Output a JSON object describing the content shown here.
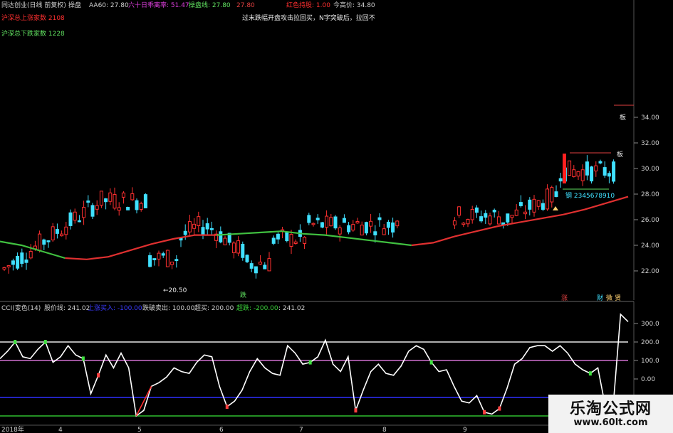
{
  "header": {
    "items": [
      {
        "text": "同达创业(日线 前复权)",
        "color": "#cfcfcf"
      },
      {
        "text": "操盘",
        "color": "#cfcfcf"
      },
      {
        "text": "AA60: 27.80",
        "color": "#cfcfcf"
      },
      {
        "text": "六十日乖离率: 51.47",
        "color": "#e040e0"
      },
      {
        "text": "操盘线: 27.80",
        "color": "#60e060"
      },
      {
        "text": "27.80",
        "color": "#e04040"
      },
      {
        "text": "红色持股: 1.00",
        "color": "#ff3030"
      },
      {
        "text": "今高价: 34.80",
        "color": "#cfcfcf"
      }
    ],
    "line2": "过末跌幅开盘攻击拉回买，N字突破后，拉回不",
    "up_count": "沪深总上涨家数 2108",
    "down_count": "沪深总下跌家数 1228"
  },
  "upper": {
    "price_ticks": [
      "34.00",
      "32.00",
      "30.00",
      "28.00",
      "26.00",
      "24.00",
      "22.00"
    ],
    "annot_low": "←20.50",
    "annot_die": "跌",
    "annot_ban1": "板",
    "annot_ban2": "板",
    "annot_seq": "钢 2345678910",
    "annot_zhang": "涨",
    "annot_cai": "财",
    "annot_wei": "微",
    "annot_zhe": "贤"
  },
  "lower": {
    "header": [
      {
        "text": "CCI(变色(14)",
        "color": "#cfcfcf"
      },
      {
        "text": "股价线: 241.02",
        "color": "#cfcfcf"
      },
      {
        "text": "上涨买入: -100.00",
        "color": "#3a3aff"
      },
      {
        "text": "跌破卖出: 100.00",
        "color": "#cfcfcf"
      },
      {
        "text": "超买: 200.00",
        "color": "#cfcfcf"
      },
      {
        "text": "超跌: -200.00",
        "color": "#3ad03a"
      },
      {
        "text": ": 241.02",
        "color": "#cfcfcf"
      }
    ],
    "ticks": [
      "300.0",
      "200.0",
      "100.0",
      "0.00"
    ]
  },
  "date_axis": [
    "2018年",
    "4",
    "5",
    "6",
    "7",
    "8",
    "9"
  ],
  "watermark": {
    "title": "乐淘公式网",
    "url": "www.60lt.com"
  },
  "colors": {
    "up": "#ff3030",
    "down": "#40e0ff",
    "ma_up": "#e03030",
    "ma_down": "#40c040",
    "cci": "#ffffff"
  },
  "chart_data": {
    "type": "candlestick",
    "price_range": [
      20,
      35
    ],
    "ma_points": [
      24.3,
      24.0,
      23.5,
      23.0,
      22.9,
      23.1,
      23.6,
      24.1,
      24.5,
      24.8,
      24.8,
      24.9,
      25.0,
      25.1,
      24.9,
      24.8,
      24.6,
      24.4,
      24.2,
      24.0,
      24.2,
      24.7,
      25.1,
      25.5,
      25.8,
      26.1,
      26.4,
      26.8,
      27.3,
      27.8
    ],
    "cci_levels": {
      "overbought": 200,
      "sell": 100,
      "buy": -100,
      "oversold": -200
    },
    "cci_range": [
      -200,
      350
    ]
  }
}
